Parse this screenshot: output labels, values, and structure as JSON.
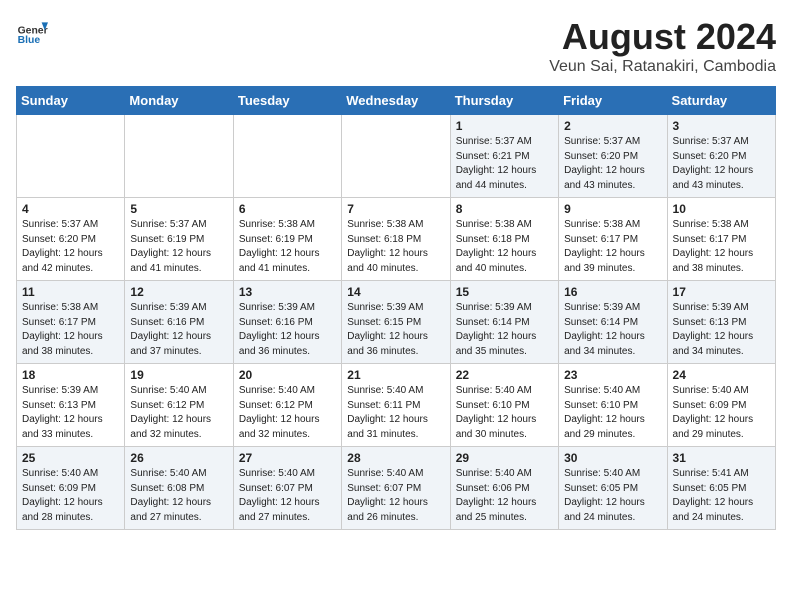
{
  "logo": {
    "general": "General",
    "blue": "Blue"
  },
  "title": "August 2024",
  "subtitle": "Veun Sai, Ratanakiri, Cambodia",
  "days_of_week": [
    "Sunday",
    "Monday",
    "Tuesday",
    "Wednesday",
    "Thursday",
    "Friday",
    "Saturday"
  ],
  "weeks": [
    [
      {
        "day": "",
        "info": ""
      },
      {
        "day": "",
        "info": ""
      },
      {
        "day": "",
        "info": ""
      },
      {
        "day": "",
        "info": ""
      },
      {
        "day": "1",
        "info": "Sunrise: 5:37 AM\nSunset: 6:21 PM\nDaylight: 12 hours\nand 44 minutes."
      },
      {
        "day": "2",
        "info": "Sunrise: 5:37 AM\nSunset: 6:20 PM\nDaylight: 12 hours\nand 43 minutes."
      },
      {
        "day": "3",
        "info": "Sunrise: 5:37 AM\nSunset: 6:20 PM\nDaylight: 12 hours\nand 43 minutes."
      }
    ],
    [
      {
        "day": "4",
        "info": "Sunrise: 5:37 AM\nSunset: 6:20 PM\nDaylight: 12 hours\nand 42 minutes."
      },
      {
        "day": "5",
        "info": "Sunrise: 5:37 AM\nSunset: 6:19 PM\nDaylight: 12 hours\nand 41 minutes."
      },
      {
        "day": "6",
        "info": "Sunrise: 5:38 AM\nSunset: 6:19 PM\nDaylight: 12 hours\nand 41 minutes."
      },
      {
        "day": "7",
        "info": "Sunrise: 5:38 AM\nSunset: 6:18 PM\nDaylight: 12 hours\nand 40 minutes."
      },
      {
        "day": "8",
        "info": "Sunrise: 5:38 AM\nSunset: 6:18 PM\nDaylight: 12 hours\nand 40 minutes."
      },
      {
        "day": "9",
        "info": "Sunrise: 5:38 AM\nSunset: 6:17 PM\nDaylight: 12 hours\nand 39 minutes."
      },
      {
        "day": "10",
        "info": "Sunrise: 5:38 AM\nSunset: 6:17 PM\nDaylight: 12 hours\nand 38 minutes."
      }
    ],
    [
      {
        "day": "11",
        "info": "Sunrise: 5:38 AM\nSunset: 6:17 PM\nDaylight: 12 hours\nand 38 minutes."
      },
      {
        "day": "12",
        "info": "Sunrise: 5:39 AM\nSunset: 6:16 PM\nDaylight: 12 hours\nand 37 minutes."
      },
      {
        "day": "13",
        "info": "Sunrise: 5:39 AM\nSunset: 6:16 PM\nDaylight: 12 hours\nand 36 minutes."
      },
      {
        "day": "14",
        "info": "Sunrise: 5:39 AM\nSunset: 6:15 PM\nDaylight: 12 hours\nand 36 minutes."
      },
      {
        "day": "15",
        "info": "Sunrise: 5:39 AM\nSunset: 6:14 PM\nDaylight: 12 hours\nand 35 minutes."
      },
      {
        "day": "16",
        "info": "Sunrise: 5:39 AM\nSunset: 6:14 PM\nDaylight: 12 hours\nand 34 minutes."
      },
      {
        "day": "17",
        "info": "Sunrise: 5:39 AM\nSunset: 6:13 PM\nDaylight: 12 hours\nand 34 minutes."
      }
    ],
    [
      {
        "day": "18",
        "info": "Sunrise: 5:39 AM\nSunset: 6:13 PM\nDaylight: 12 hours\nand 33 minutes."
      },
      {
        "day": "19",
        "info": "Sunrise: 5:40 AM\nSunset: 6:12 PM\nDaylight: 12 hours\nand 32 minutes."
      },
      {
        "day": "20",
        "info": "Sunrise: 5:40 AM\nSunset: 6:12 PM\nDaylight: 12 hours\nand 32 minutes."
      },
      {
        "day": "21",
        "info": "Sunrise: 5:40 AM\nSunset: 6:11 PM\nDaylight: 12 hours\nand 31 minutes."
      },
      {
        "day": "22",
        "info": "Sunrise: 5:40 AM\nSunset: 6:10 PM\nDaylight: 12 hours\nand 30 minutes."
      },
      {
        "day": "23",
        "info": "Sunrise: 5:40 AM\nSunset: 6:10 PM\nDaylight: 12 hours\nand 29 minutes."
      },
      {
        "day": "24",
        "info": "Sunrise: 5:40 AM\nSunset: 6:09 PM\nDaylight: 12 hours\nand 29 minutes."
      }
    ],
    [
      {
        "day": "25",
        "info": "Sunrise: 5:40 AM\nSunset: 6:09 PM\nDaylight: 12 hours\nand 28 minutes."
      },
      {
        "day": "26",
        "info": "Sunrise: 5:40 AM\nSunset: 6:08 PM\nDaylight: 12 hours\nand 27 minutes."
      },
      {
        "day": "27",
        "info": "Sunrise: 5:40 AM\nSunset: 6:07 PM\nDaylight: 12 hours\nand 27 minutes."
      },
      {
        "day": "28",
        "info": "Sunrise: 5:40 AM\nSunset: 6:07 PM\nDaylight: 12 hours\nand 26 minutes."
      },
      {
        "day": "29",
        "info": "Sunrise: 5:40 AM\nSunset: 6:06 PM\nDaylight: 12 hours\nand 25 minutes."
      },
      {
        "day": "30",
        "info": "Sunrise: 5:40 AM\nSunset: 6:05 PM\nDaylight: 12 hours\nand 24 minutes."
      },
      {
        "day": "31",
        "info": "Sunrise: 5:41 AM\nSunset: 6:05 PM\nDaylight: 12 hours\nand 24 minutes."
      }
    ]
  ]
}
